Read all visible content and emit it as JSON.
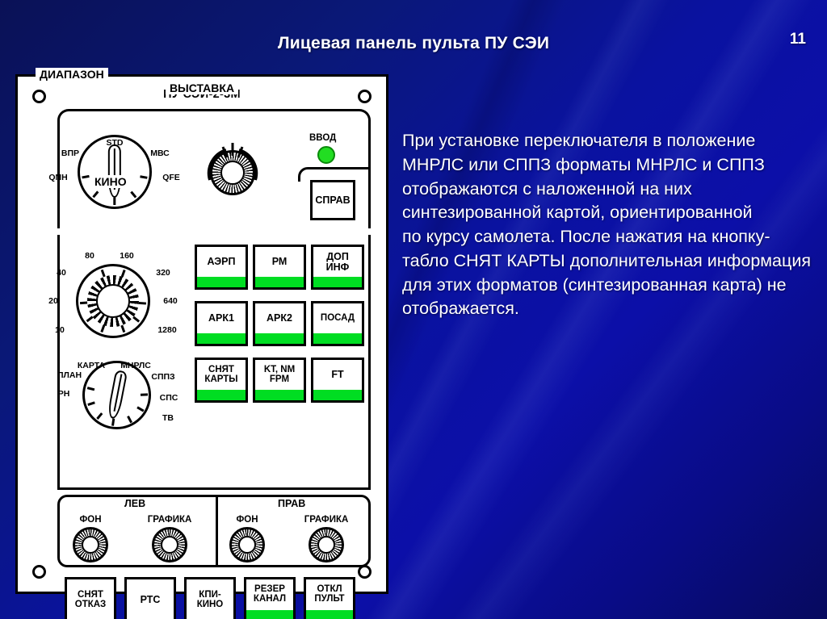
{
  "slide": {
    "title": "Лицевая панель пульта ПУ СЭИ",
    "page_number": "11",
    "background_color": "#0a12a0",
    "title_color": "#ffffff"
  },
  "panel": {
    "model_label": "ПУ СЭИ-2-3М",
    "lamp_color": "#00dd22",
    "frame_color": "#000000",
    "face_color": "#ffffff",
    "groups": {
      "vystavka": {
        "label": "ВЫСТАВКА"
      },
      "diapazon": {
        "label": "ДИАПАЗОН"
      },
      "kino": {
        "label": "КИНО"
      },
      "lev": {
        "label": "ЛЕВ"
      },
      "prav": {
        "label": "ПРАВ"
      }
    },
    "vystavka_dial": {
      "label": "ВЫСТАВКА",
      "selected": "STD",
      "positions": [
        "QNH",
        "ВПР",
        "STD",
        "МВС",
        "QFE"
      ]
    },
    "encoder": {
      "name": "rotary-encoder"
    },
    "vvod": {
      "label": "ВВОД",
      "state": "on",
      "color": "#00dd22"
    },
    "sprav_button": {
      "label": "СПРАВ",
      "lamp": false
    },
    "diapazon_dial": {
      "label": "ДИАПАЗОН",
      "positions": [
        "10",
        "20",
        "40",
        "80",
        "160",
        "320",
        "640",
        "1280"
      ]
    },
    "kino_dial": {
      "label": "КИНО",
      "selected": "МНРЛС",
      "positions": [
        "РН",
        "ПЛАН",
        "КАРТА",
        "МНРЛС",
        "СППЗ",
        "СПС",
        "ТВ"
      ]
    },
    "button_grid": [
      {
        "label": "АЭРП",
        "lamp": true
      },
      {
        "label": "РМ",
        "lamp": true
      },
      {
        "label": "ДОП\nИНФ",
        "lamp": true
      },
      {
        "label": "АРК1",
        "lamp": true
      },
      {
        "label": "АРК2",
        "lamp": true
      },
      {
        "label": "ПОСАД",
        "lamp": true
      },
      {
        "label": "СНЯТ\nКАРТЫ",
        "lamp": true
      },
      {
        "label": "KT, NM\nFPM",
        "lamp": true
      },
      {
        "label": "FT",
        "lamp": true
      }
    ],
    "pots": [
      {
        "section": "ЛЕВ",
        "label": "ФОН"
      },
      {
        "section": "ЛЕВ",
        "label": "ГРАФИКА"
      },
      {
        "section": "ПРАВ",
        "label": "ФОН"
      },
      {
        "section": "ПРАВ",
        "label": "ГРАФИКА"
      }
    ],
    "bottom_buttons": [
      {
        "label": "СНЯТ\nОТКАЗ",
        "lamp": false
      },
      {
        "label": "РТС",
        "lamp": false
      },
      {
        "label": "КПИ-\nКИНО",
        "lamp": false
      },
      {
        "label": "РЕЗЕР\nКАНАЛ",
        "lamp": true
      },
      {
        "label": "ОТКЛ\nПУЛЬТ",
        "lamp": true
      }
    ]
  },
  "description": {
    "text": "При установке переключателя в положение МНРЛС или СППЗ форматы МНРЛС и СППЗ отображаются с наложенной на них синтезированной картой, ориентированной\nпо курсу самолета. После нажатия на кнопку-табло СНЯТ КАРТЫ дополнительная информация для этих форматов (синтезированная карта) не отображается."
  }
}
